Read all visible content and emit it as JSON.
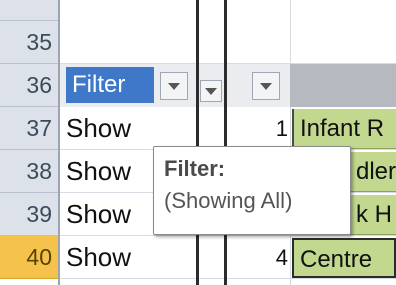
{
  "rows": [
    {
      "number": "35"
    },
    {
      "number": "36"
    },
    {
      "number": "37",
      "text": "Show",
      "num": "1",
      "green": "Infant R"
    },
    {
      "number": "38",
      "text": "Show",
      "num": "",
      "green": "dler"
    },
    {
      "number": "39",
      "text": "Show",
      "num": "",
      "green": "k H"
    },
    {
      "number": "40",
      "text": "Show",
      "num": "4",
      "green": "Centre"
    }
  ],
  "filter_header": {
    "label": "Filter"
  },
  "tooltip": {
    "title": "Filter:",
    "body": "(Showing All)"
  },
  "colors": {
    "filter_header_bg": "#3f78c9",
    "active_row_header": "#f5c34b",
    "green_cell": "#c3d88f",
    "row_header_bg": "#dde2ea"
  }
}
